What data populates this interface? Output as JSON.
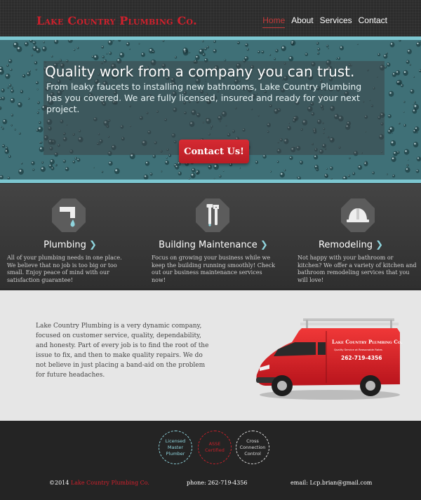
{
  "header": {
    "logo": "Lake Country Plumbing Co.",
    "nav": [
      {
        "label": "Home",
        "active": true
      },
      {
        "label": "About",
        "active": false
      },
      {
        "label": "Services",
        "active": false
      },
      {
        "label": "Contact",
        "active": false
      }
    ]
  },
  "hero": {
    "title": "Quality work from a company you can trust.",
    "subtitle": "From leaky faucets to installing new bathrooms, Lake Country Plumbing has you covered. We are fully licensed, insured and ready for your next project.",
    "cta_label": "Contact Us!"
  },
  "services": [
    {
      "title": "Plumbing",
      "icon": "faucet-icon",
      "description": "All of your plumbing needs in one place. We believe that no job is too big or too small. Enjoy peace of mind with our satisfaction guarantee!"
    },
    {
      "title": "Building Maintenance",
      "icon": "wrench-icon",
      "description": "Focus on growing your business while we keep the building running smoothly! Check out our business maintenance services now!"
    },
    {
      "title": "Remodeling",
      "icon": "hard-hat-icon",
      "description": "Not happy with your bathroom or kitchen? We offer a variety of kitchen and bathroom remodeling services that you will love!"
    }
  ],
  "chevron": "❯",
  "about": {
    "text": "Lake Country Plumbing is a very dynamic company, focused on customer service, quality, dependability, and honesty. Part of every job is to find the root of the issue to fix, and then to make quality repairs. We do not believe in just placing a band-aid on the problem for future headaches.",
    "van_brand": "Lake Country Plumbing Co.",
    "van_tagline": "Quality Service at Reasonable Rates",
    "van_phone": "262-719-4356"
  },
  "footer": {
    "badges": [
      {
        "lines": [
          "Licensed",
          "Master",
          "Plumber"
        ],
        "color": "#8fd4dd"
      },
      {
        "lines": [
          "ASSE",
          "Certified"
        ],
        "color": "#c8202a"
      },
      {
        "lines": [
          "Cross",
          "Connection",
          "Control"
        ],
        "color": "#dddddd"
      }
    ],
    "copyright_prefix": "©2014",
    "copyright_brand": "Lake Country Plumbing Co.",
    "phone": "phone: 262-719-4356",
    "email": "email: Lcp.brian@gmail.com"
  },
  "colors": {
    "brand_red": "#d0202c",
    "accent_teal": "#7cc6d0",
    "header_bg": "#2c2c2c",
    "services_bg": "#3a3a3a",
    "about_bg": "#e6e6e6",
    "footer_bg": "#242424"
  }
}
